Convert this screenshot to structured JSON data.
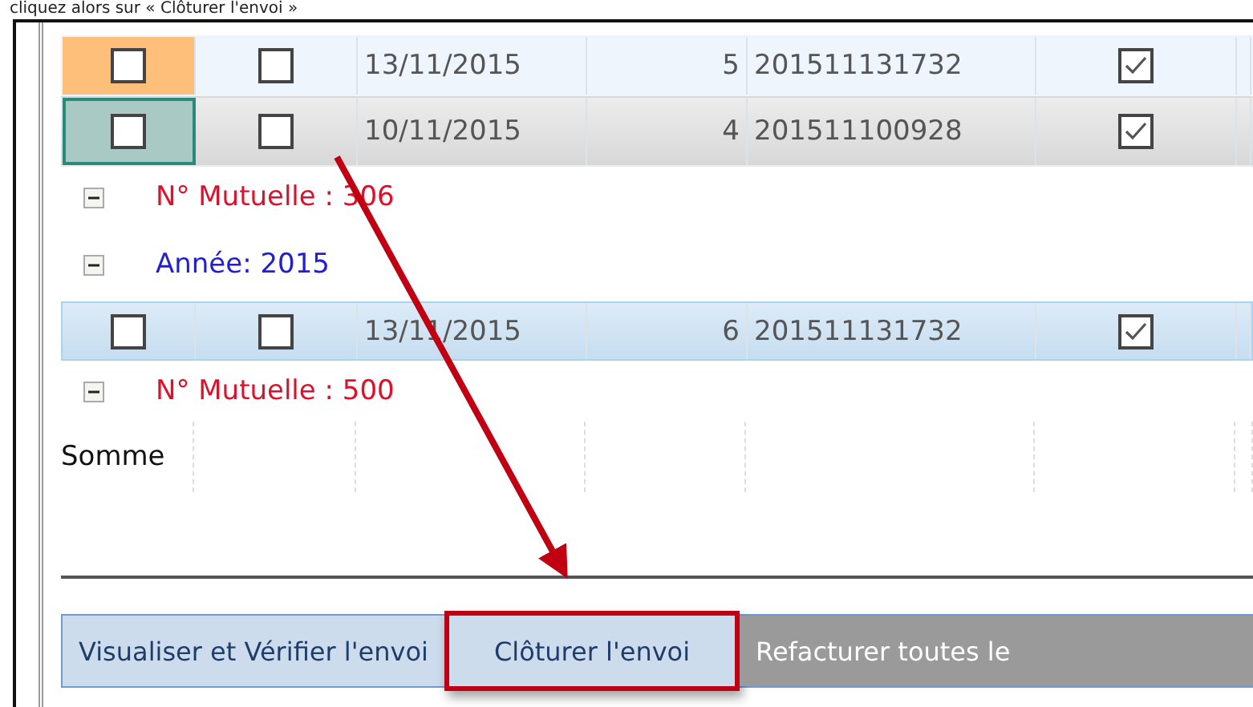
{
  "caption": "cliquez alors sur « Clôturer l'envoi »",
  "grid": {
    "items": [
      {
        "kind": "row",
        "hovered": true,
        "focused": false,
        "selected": false,
        "check_a": false,
        "check_b": false,
        "date": "13/11/2015",
        "number": "5",
        "reference": "201511131732",
        "validated": true
      },
      {
        "kind": "row",
        "hovered": false,
        "focused": true,
        "selected": false,
        "check_a": false,
        "check_b": false,
        "date": "10/11/2015",
        "number": "4",
        "reference": "201511100928",
        "validated": true
      },
      {
        "kind": "group",
        "expanded": true,
        "color": "#e0102a",
        "label": "N° Mutuelle : 306"
      },
      {
        "kind": "group",
        "expanded": true,
        "color": "#2020d0",
        "label": "Année: 2015"
      },
      {
        "kind": "row",
        "hovered": false,
        "focused": false,
        "selected": true,
        "check_a": false,
        "check_b": false,
        "date": "13/11/2015",
        "number": "6",
        "reference": "201511131732",
        "validated": true
      },
      {
        "kind": "group",
        "expanded": true,
        "color": "#e0102a",
        "label": "N° Mutuelle : 500"
      }
    ],
    "summary": "Somme"
  },
  "buttons": [
    {
      "label": "Visualiser et Vérifier l'envoi",
      "disabled": false,
      "highlighted": false
    },
    {
      "label": "Clôturer l'envoi",
      "disabled": false,
      "highlighted": true
    },
    {
      "label": "Refacturer toutes le",
      "disabled": true,
      "highlighted": false
    }
  ]
}
